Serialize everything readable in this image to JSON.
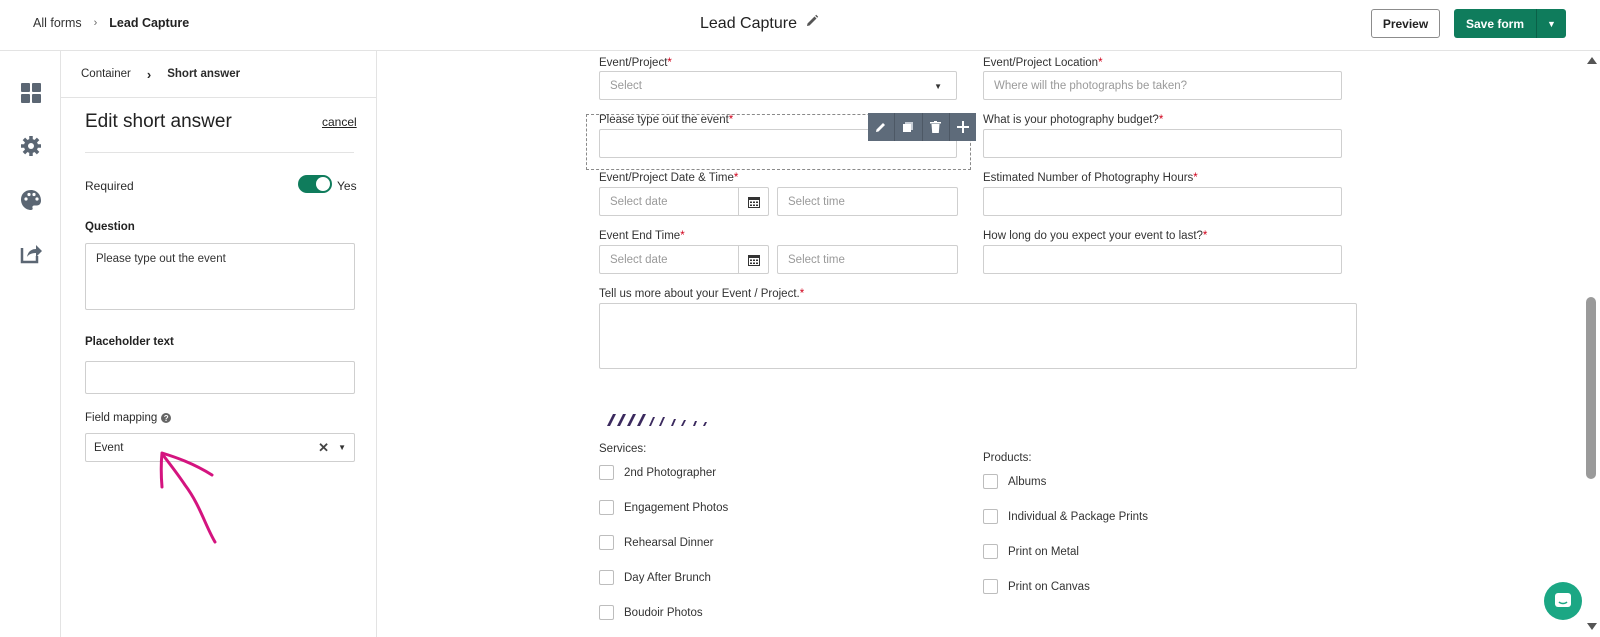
{
  "topbar": {
    "breadcrumb_root": "All forms",
    "breadcrumb_current": "Lead Capture",
    "title": "Lead Capture",
    "preview_label": "Preview",
    "save_label": "Save form"
  },
  "rail": {
    "icons": [
      "dashboard-icon",
      "gear-icon",
      "palette-icon",
      "share-icon"
    ]
  },
  "panel": {
    "crumb_parent": "Container",
    "crumb_current": "Short answer",
    "title": "Edit short answer",
    "cancel_label": "cancel",
    "required_label": "Required",
    "required_value": "Yes",
    "question_label": "Question",
    "question_value": "Please type out the event",
    "placeholder_label": "Placeholder text",
    "placeholder_value": "",
    "field_mapping_label": "Field mapping",
    "field_mapping_value": "Event"
  },
  "form": {
    "event_project": {
      "label": "Event/Project",
      "placeholder": "Select"
    },
    "event_location": {
      "label": "Event/Project Location",
      "placeholder": "Where will the photographs be taken?"
    },
    "type_event": {
      "label": "Please type out the event"
    },
    "budget": {
      "label": "What is your photography budget?"
    },
    "date_time": {
      "label": "Event/Project Date & Time",
      "date_placeholder": "Select date",
      "time_placeholder": "Select time"
    },
    "hours": {
      "label": "Estimated Number of Photography Hours"
    },
    "end_time": {
      "label": "Event End Time",
      "date_placeholder": "Select date",
      "time_placeholder": "Select time"
    },
    "duration": {
      "label": "How long do you expect your event to last?"
    },
    "more": {
      "label": "Tell us more about your Event / Project."
    },
    "services_label": "Services:",
    "services": [
      "2nd Photographer",
      "Engagement Photos",
      "Rehearsal Dinner",
      "Day After Brunch",
      "Boudoir Photos"
    ],
    "products_label": "Products:",
    "products": [
      "Albums",
      "Individual & Package Prints",
      "Print on Metal",
      "Print on Canvas"
    ],
    "required_mark": "*"
  },
  "colors": {
    "accent": "#0f7c5c",
    "required": "#d0021b",
    "annotation": "#d4147f",
    "toolbar": "#5e6b7a"
  }
}
